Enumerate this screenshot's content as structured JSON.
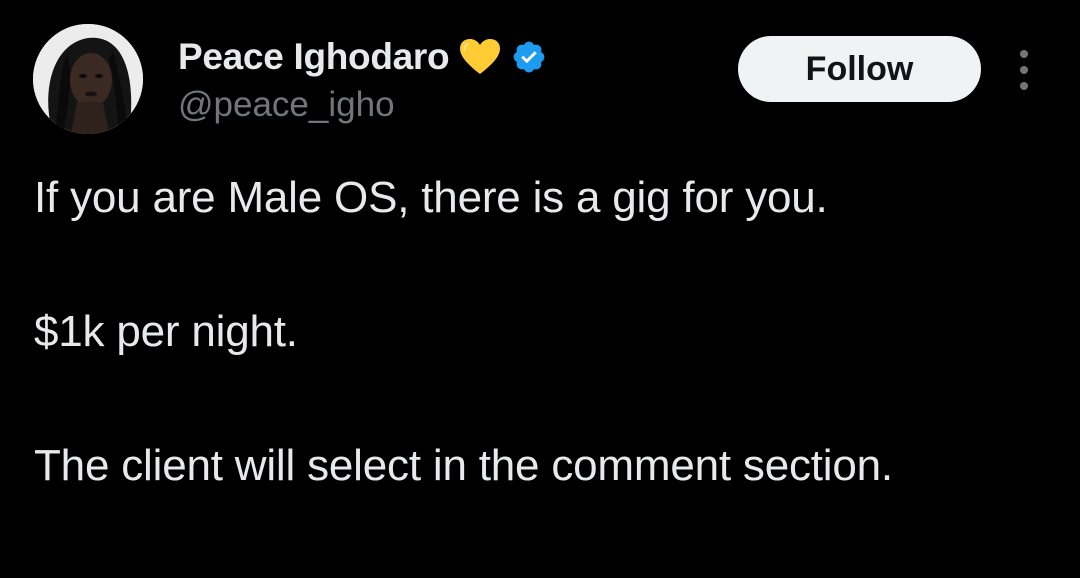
{
  "author": {
    "display_name": "Peace Ighodaro",
    "handle": "@peace_igho",
    "name_emoji": "yellow-heart-icon",
    "verified_badge": "verified-icon"
  },
  "actions": {
    "follow_label": "Follow",
    "more_icon": "more-options-icon"
  },
  "tweet": {
    "paragraphs": [
      "If you are Male OS, there is a gig for you.",
      "$1k per night.",
      "The client will select in the comment section."
    ]
  },
  "colors": {
    "background": "#000000",
    "text_primary": "#e7e9ea",
    "text_secondary": "#71767b",
    "follow_button_bg": "#eff3f4",
    "follow_button_text": "#0f1419",
    "verified_blue": "#1d9bf0",
    "heart_yellow": "#ffcc33"
  }
}
